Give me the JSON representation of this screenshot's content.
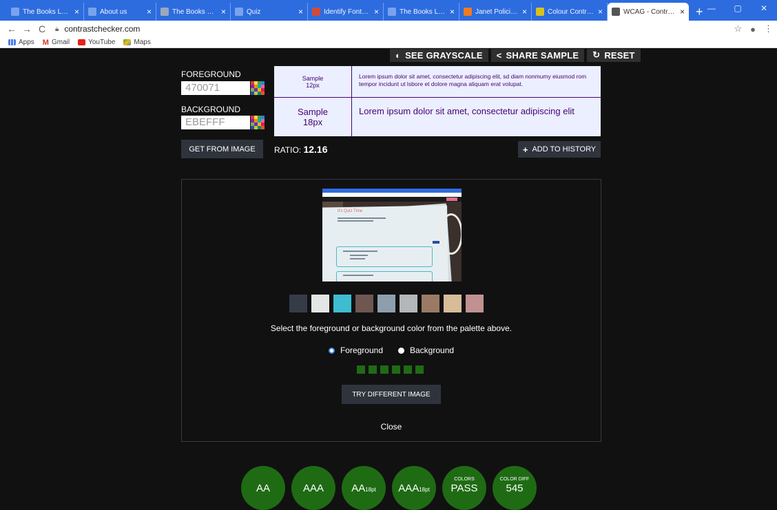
{
  "browser": {
    "tabs": [
      {
        "title": "The Books Look-I",
        "icon_color": "#7aa2ee",
        "active": false,
        "width": 112
      },
      {
        "title": "About us",
        "icon_color": "#7aa2ee",
        "active": false,
        "width": 105
      },
      {
        "title": "The Books Look-I",
        "icon_color": "#9aa8bc",
        "active": false,
        "width": 108
      },
      {
        "title": "Quiz",
        "icon_color": "#7aa2ee",
        "active": false,
        "width": 112
      },
      {
        "title": "Identify Fonts - Th",
        "icon_color": "#d04a3c",
        "active": false,
        "width": 110
      },
      {
        "title": "The Books Look-I",
        "icon_color": "#7aa2ee",
        "active": false,
        "width": 110
      },
      {
        "title": "Janet Policies and",
        "icon_color": "#f07b22",
        "active": false,
        "width": 105
      },
      {
        "title": "Colour Contrast C",
        "icon_color": "#d9c21b",
        "active": false,
        "width": 110
      },
      {
        "title": "WCAG - Contrast",
        "icon_color": "#555555",
        "active": true,
        "width": 118
      }
    ],
    "tab_close": "×",
    "new_tab": "+",
    "window_controls": [
      "—",
      "▢",
      "✕"
    ],
    "address": "contrastchecker.com",
    "bookmarks": [
      {
        "label": "Apps",
        "icon_color": "#4a7de8"
      },
      {
        "label": "Gmail",
        "icon_color": "#d93025"
      },
      {
        "label": "YouTube",
        "icon_color": "#e62117"
      },
      {
        "label": "Maps",
        "icon_color": "#34a853"
      }
    ]
  },
  "toolbar": {
    "grayscale": "SEE GRAYSCALE",
    "share": "SHARE SAMPLE",
    "reset": "RESET"
  },
  "foreground": {
    "label": "FOREGROUND",
    "value": "470071",
    "color": "#470071"
  },
  "background": {
    "label": "BACKGROUND",
    "value": "EBEFFF",
    "color": "#EBEFFF"
  },
  "samples": {
    "small_label_1": "Sample",
    "small_label_2": "12px",
    "large_label_1": "Sample",
    "large_label_2": "18px",
    "small_text": "Lorem ipsum dolor sit amet, consectetur adipiscing elit, sd diam nonmumy eiusmod rom tempor incidunt ut lsbore et dolore magna aliquam erat volupat.",
    "large_text": "Lorem ipsum dolor sit amet, consectetur adipiscing elit"
  },
  "actions": {
    "get_from_image": "GET FROM IMAGE",
    "ratio_label": "RATIO:",
    "ratio_value": "12.16",
    "add_history": "ADD TO HISTORY"
  },
  "picker": {
    "screenshot_title": "It's Quiz Time",
    "palette": [
      "#353c47",
      "#e3e6e5",
      "#3ebdd0",
      "#6f5651",
      "#8f9eac",
      "#b4b7ba",
      "#9a7a64",
      "#d7bc98",
      "#c09190"
    ],
    "instruction": "Select the foreground or background color from the palette above.",
    "radio_foreground": "Foreground",
    "radio_background": "Background",
    "selected": "Foreground",
    "sampled_colors": [
      "#1f6b14",
      "#1f6b14",
      "#1f6b14",
      "#1f6b14",
      "#1f6b14",
      "#1f6b14"
    ],
    "try_different": "TRY DIFFERENT IMAGE",
    "close": "Close"
  },
  "results": [
    {
      "top": "",
      "main": "AA",
      "sub": ""
    },
    {
      "top": "",
      "main": "AAA",
      "sub": ""
    },
    {
      "top": "",
      "main": "AA",
      "sub": "18pt"
    },
    {
      "top": "",
      "main": "AAA",
      "sub": "18pt"
    },
    {
      "top": "COLORS",
      "main": "PASS",
      "sub": ""
    },
    {
      "top": "COLOR DIFF",
      "main": "545",
      "sub": ""
    }
  ],
  "accent_pass": "#1f6b14"
}
